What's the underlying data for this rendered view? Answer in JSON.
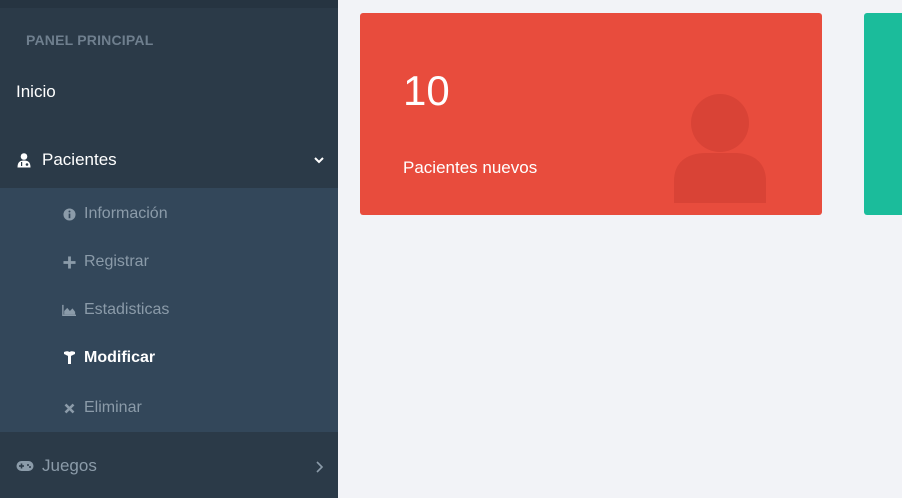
{
  "sidebar": {
    "section_label": "PANEL PRINCIPAL",
    "inicio": "Inicio",
    "pacientes": {
      "label": "Pacientes",
      "icon": "user-md-icon",
      "expanded": true,
      "items": [
        {
          "label": "Información",
          "icon": "info-circle-icon"
        },
        {
          "label": "Registrar",
          "icon": "plus-icon"
        },
        {
          "label": "Estadisticas",
          "icon": "area-chart-icon"
        },
        {
          "label": "Modificar",
          "icon": "wrench-icon",
          "active": true
        },
        {
          "label": "Eliminar",
          "icon": "times-icon"
        }
      ]
    },
    "juegos": {
      "label": "Juegos",
      "icon": "gamepad-icon"
    }
  },
  "cards": [
    {
      "value": "10",
      "caption": "Pacientes nuevos",
      "color": "#e84c3d",
      "icon": "user-icon"
    },
    {
      "color": "#1bbc9b"
    }
  ],
  "colors": {
    "sidebar_bg": "#2b3a48",
    "submenu_bg": "#33475a",
    "content_bg": "#f2f3f7"
  }
}
